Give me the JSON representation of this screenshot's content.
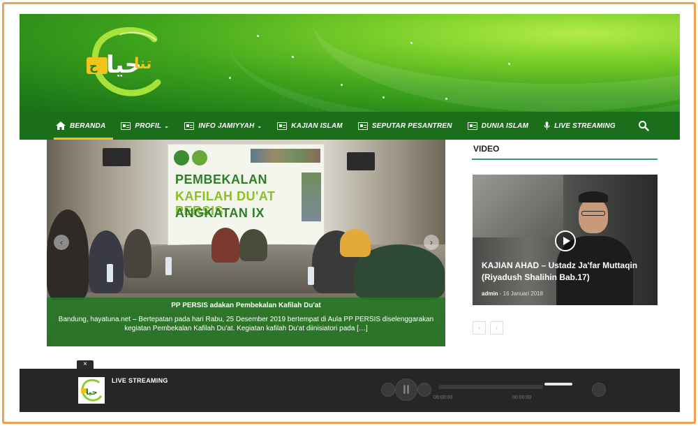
{
  "site": {
    "logo_alt": "hayatuna logo"
  },
  "nav": {
    "items": [
      {
        "label": "BERANDA",
        "icon": "home-icon",
        "active": true,
        "dropdown": false
      },
      {
        "label": "PROFIL",
        "icon": "id-card-icon",
        "active": false,
        "dropdown": true
      },
      {
        "label": "INFO JAMIYYAH",
        "icon": "id-card-icon",
        "active": false,
        "dropdown": true
      },
      {
        "label": "KAJIAN ISLAM",
        "icon": "id-card-icon",
        "active": false,
        "dropdown": false
      },
      {
        "label": "SEPUTAR PESANTREN",
        "icon": "id-card-icon",
        "active": false,
        "dropdown": false
      },
      {
        "label": "DUNIA ISLAM",
        "icon": "id-card-icon",
        "active": false,
        "dropdown": false
      },
      {
        "label": "LIVE STREAMING",
        "icon": "microphone-icon",
        "active": false,
        "dropdown": false
      }
    ],
    "search_icon": "search-icon",
    "chevron": "⌄"
  },
  "slider": {
    "poster_lines": [
      "PEMBEKALAN",
      "KAFILAH DU'AT PERSIS",
      "ANGKATAN IX"
    ],
    "caption_title": "PP PERSIS adakan Pembekalan Kafilah Du'at",
    "caption_text": "Bandung, hayatuna.net – Bertepatan pada hari Rabu, 25 Desember 2019 bertempat di Aula PP PERSIS diselenggarakan kegiatan Pembekalan Kafilah Du'at. Kegiatan kafilah Du'at diinisiatori pada […]",
    "prev": "‹",
    "next": "›"
  },
  "sidebar": {
    "widget_title": "VIDEO",
    "video": {
      "title": "KAJIAN AHAD – Ustadz Ja'far Muttaqin (Riyadush Shalihin Bab.17)",
      "author": "admin",
      "separator": " - ",
      "date": "16 Januari 2018"
    },
    "pager_prev": "‹",
    "pager_next": "›"
  },
  "live": {
    "close": "×",
    "title": "LIVE STREAMING",
    "time_start": "00:00:00",
    "time_end": "00:00:00"
  },
  "colors": {
    "nav_bg": "#1b6f1b",
    "accent": "#f5c11a",
    "caption_bg": "#227822",
    "frame": "#f0a050"
  }
}
